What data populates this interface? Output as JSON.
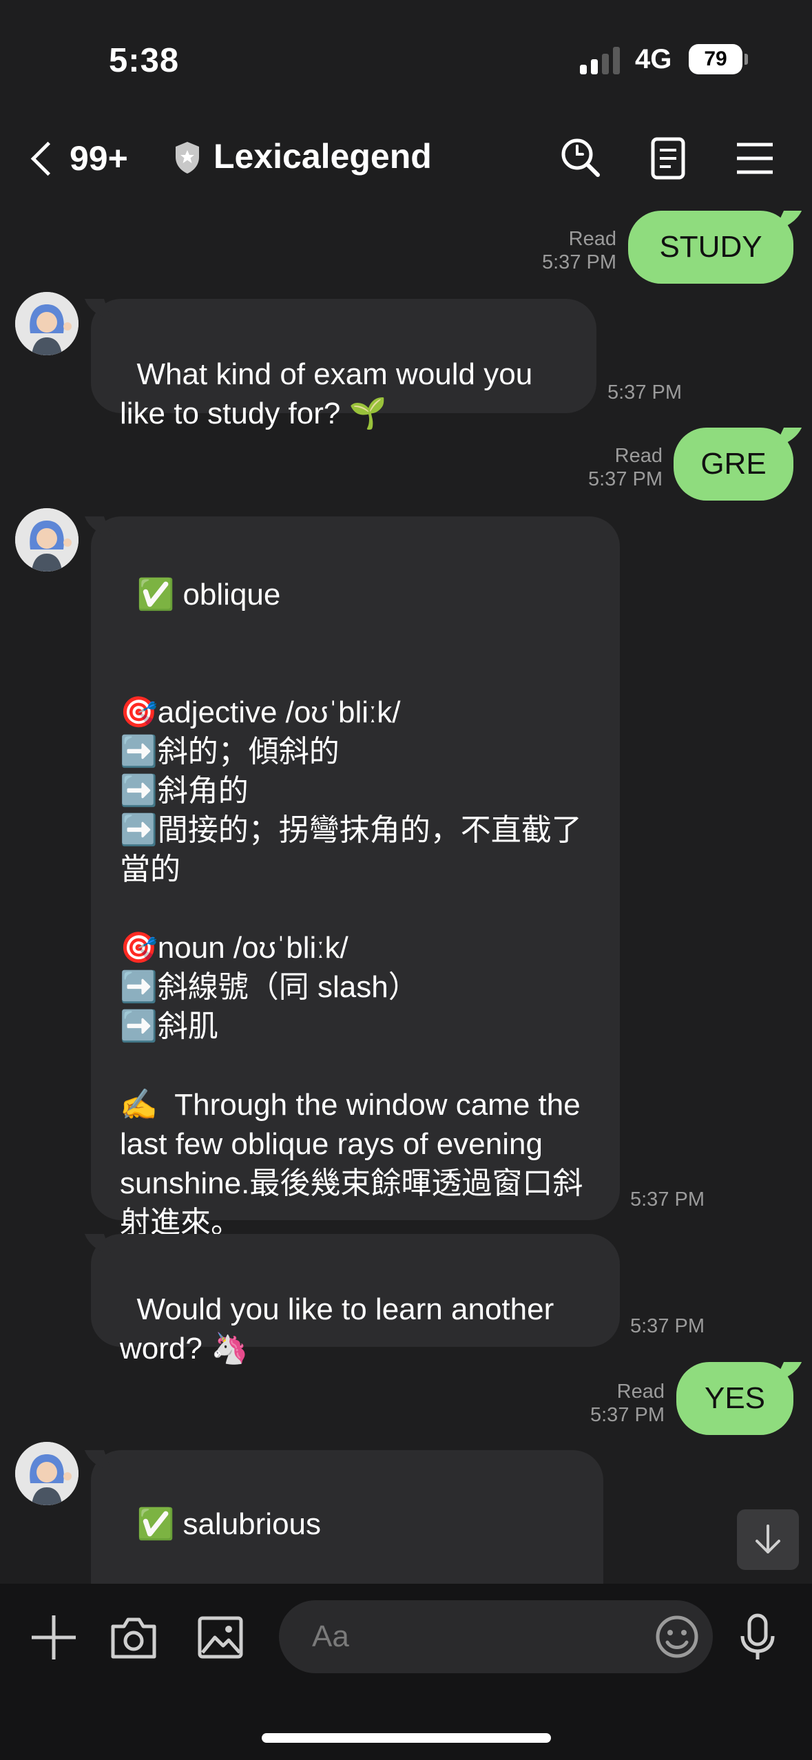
{
  "status_bar": {
    "time": "5:38",
    "network": "4G",
    "battery": "79"
  },
  "header": {
    "back_count": "99+",
    "title": "Lexicalegend"
  },
  "messages": {
    "m1": {
      "text": "STUDY",
      "read": "Read",
      "time": "5:37 PM"
    },
    "m2": {
      "text": "What kind of exam would you like to study for? 🌱",
      "time": "5:37 PM"
    },
    "m3": {
      "text": "GRE",
      "read": "Read",
      "time": "5:37 PM"
    },
    "m4": {
      "text": "✅ oblique\n\n\n🎯adjective /oʊˈbliːk/\n➡️斜的；傾斜的\n➡️斜角的\n➡️間接的；拐彎抹角的，不直截了當的\n\n🎯noun /oʊˈbliːk/\n➡️斜線號（同 slash）\n➡️斜肌\n\n✍️  Through the window came the last few oblique rays of evening sunshine.最後幾束餘暉透過窗口斜射進來。",
      "time": "5:37 PM"
    },
    "m5": {
      "text": "Would you like to learn another word? 🦄",
      "time": "5:37 PM"
    },
    "m6": {
      "text": "YES",
      "read": "Read",
      "time": "5:37 PM"
    },
    "m7": {
      "text": "✅ salubrious"
    }
  },
  "input": {
    "placeholder": "Aa"
  },
  "colors": {
    "background": "#1e1e1f",
    "incoming_bubble": "#2c2c2e",
    "outgoing_bubble": "#8fdc7e",
    "meta_text": "#9b9b9b"
  }
}
